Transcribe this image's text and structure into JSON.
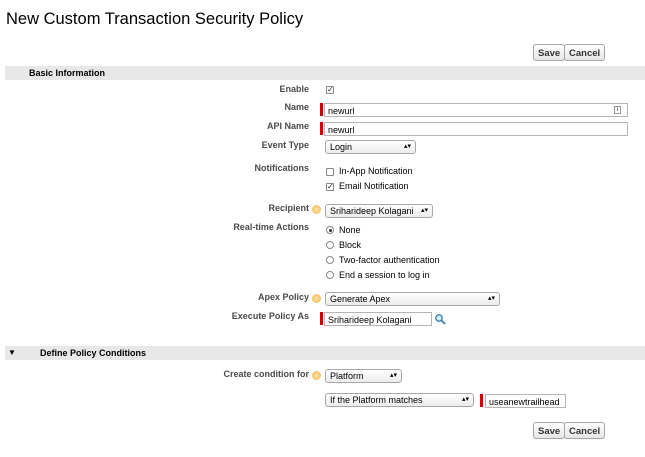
{
  "title": "New Custom Transaction Security Policy",
  "buttons": {
    "save": "Save",
    "cancel": "Cancel"
  },
  "basic": {
    "header": "Basic Information",
    "enable_label": "Enable",
    "name_label": "Name",
    "name_value": "newurl",
    "api_label": "API Name",
    "api_value": "newurl",
    "event_label": "Event Type",
    "event_value": "Login",
    "notifications_label": "Notifications",
    "notif_inapp": "In-App Notification",
    "notif_email": "Email Notification",
    "recipient_label": "Recipient",
    "recipient_value": "Sriharideep Kolagani",
    "actions_label": "Real-time Actions",
    "actions": [
      "None",
      "Block",
      "Two-factor authentication",
      "End a session to log in"
    ],
    "apex_label": "Apex Policy",
    "apex_value": "Generate Apex",
    "execute_label": "Execute Policy As",
    "execute_value": "Sriharideep Kolagani"
  },
  "conditions": {
    "header": "Define Policy Conditions",
    "create_label": "Create condition for",
    "create_value": "Platform",
    "match_value": "If the Platform matches",
    "match_input": "useanewtrailhead"
  },
  "state": {
    "enable": true,
    "inapp": false,
    "email": true,
    "action_selected": 0
  }
}
